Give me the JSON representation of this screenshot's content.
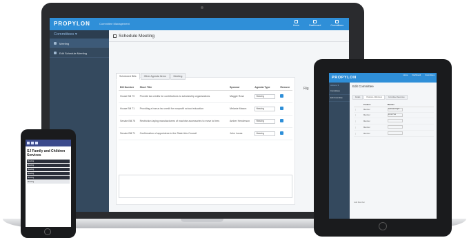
{
  "laptop": {
    "brand": "PROPYLON",
    "brand_sub": "Committee Management",
    "topnav": [
      {
        "label": "Home"
      },
      {
        "label": "Dashboard"
      },
      {
        "label": "Committees"
      }
    ],
    "sidebar": {
      "heading": "Committees ▾",
      "items": [
        {
          "label": "Meeting"
        },
        {
          "label": "Edit Schedule Meeting"
        }
      ]
    },
    "page_title": "Schedule Meeting",
    "tabs": [
      "Scheduled Bills",
      "Other Agenda Items",
      "Meeting"
    ],
    "right_col_label": "Rig",
    "table": {
      "headers": [
        "Bill Number",
        "Short Title",
        "Sponsor",
        "Agenda Type",
        "Remove"
      ],
      "rows": [
        {
          "bill": "House Bill 79",
          "title": "Provide tax credits for contributions to scholarship organizations",
          "sponsor": "Maggie Rose",
          "type": "Hearing"
        },
        {
          "bill": "House Bill 71",
          "title": "Providing a bonus tax credit for nonprofit school education",
          "sponsor": "Melanie Mason",
          "type": "Hearing"
        },
        {
          "bill": "Senate Bill 75",
          "title": "Restriction laying manufacturers of machine accessories to move to fees",
          "sponsor": "Amber Henderson",
          "type": "Hearing"
        },
        {
          "bill": "Senate Bill 71",
          "title": "Confirmation of appointees to the State Arts Council",
          "sponsor": "John Lucas",
          "type": "Hearing"
        }
      ]
    }
  },
  "tablet": {
    "brand": "PROPYLON",
    "topnav": [
      {
        "label": "Home"
      },
      {
        "label": "Dashboard"
      },
      {
        "label": "Committees"
      }
    ],
    "sidebar": {
      "heading": "Actions ▾",
      "items": [
        {
          "label": "Committees"
        },
        {
          "label": "Edit Committee"
        }
      ]
    },
    "page_title": "Edit Committee",
    "tabs": [
      "Details",
      "Positions & Members",
      "Committee Resources"
    ],
    "table": {
      "headers": [
        "",
        "Position",
        "Member"
      ],
      "rows": [
        {
          "position": "Member",
          "member": "Gertrude Knight"
        },
        {
          "position": "Member",
          "member": "Rocio Park"
        },
        {
          "position": "Member",
          "member": ""
        },
        {
          "position": "Member",
          "member": ""
        },
        {
          "position": "Member",
          "member": ""
        }
      ]
    },
    "footer_note": "Add Member"
  },
  "phone": {
    "title": "SJ Family and Children Services",
    "rows": [
      {
        "label": "Meeting",
        "style": "dark"
      },
      {
        "label": "Meeting",
        "style": "dark"
      },
      {
        "label": "Meeting",
        "style": "dark"
      },
      {
        "label": "Meeting",
        "style": "dark"
      },
      {
        "label": "Meeting",
        "style": "dark"
      },
      {
        "label": "Meeting",
        "style": "light"
      }
    ]
  }
}
